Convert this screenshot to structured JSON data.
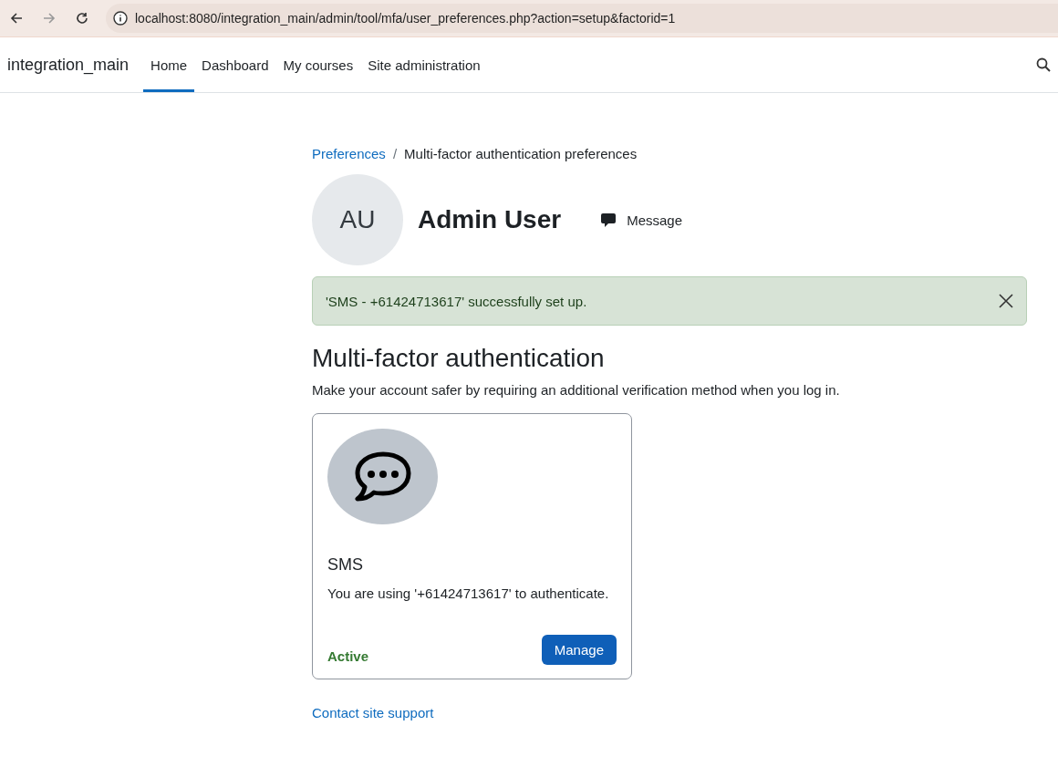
{
  "browser": {
    "url": "localhost:8080/integration_main/admin/tool/mfa/user_preferences.php?action=setup&factorid=1"
  },
  "navbar": {
    "site_name": "integration_main",
    "items": [
      {
        "label": "Home",
        "selected": true
      },
      {
        "label": "Dashboard",
        "selected": false
      },
      {
        "label": "My courses",
        "selected": false
      },
      {
        "label": "Site administration",
        "selected": false
      }
    ]
  },
  "breadcrumb_separator": "/",
  "breadcrumb": [
    {
      "label": "Preferences",
      "kind": "link"
    },
    {
      "label": "Multi-factor authentication preferences",
      "kind": "current"
    }
  ],
  "profile": {
    "initials": "AU",
    "name": "Admin User",
    "message_label": "Message"
  },
  "alert": {
    "text": "'SMS - +61424713617' successfully set up."
  },
  "heading": "Multi-factor authentication",
  "intro": "Make your account safer by requiring an additional verification method when you log in.",
  "factors": [
    {
      "title": "SMS",
      "description": "You are using '+61424713617' to authenticate.",
      "status": "Active",
      "active": true,
      "button": "Manage"
    }
  ],
  "footer_link": "Contact site support"
}
